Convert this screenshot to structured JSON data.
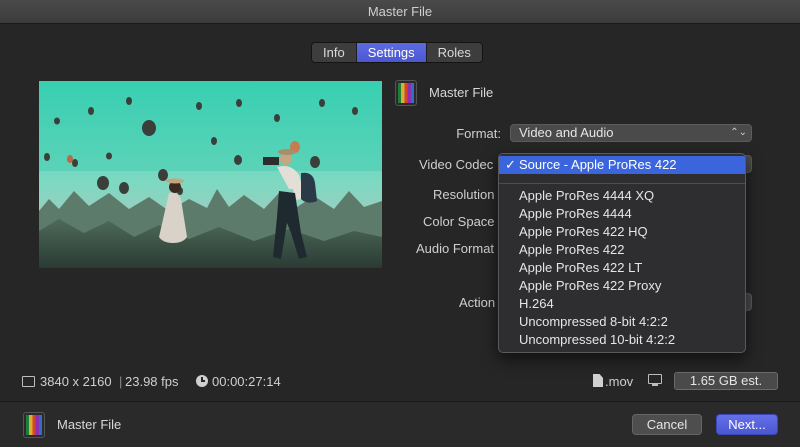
{
  "window": {
    "title": "Master File"
  },
  "tabs": [
    {
      "label": "Info"
    },
    {
      "label": "Settings",
      "active": true
    },
    {
      "label": "Roles"
    }
  ],
  "header": {
    "name": "Master File"
  },
  "fields": {
    "format": {
      "label": "Format:",
      "value": "Video and Audio"
    },
    "video_codec": {
      "label": "Video Codec"
    },
    "resolution": {
      "label": "Resolution"
    },
    "color_space": {
      "label": "Color Space"
    },
    "audio_format": {
      "label": "Audio Format"
    },
    "action": {
      "label": "Action"
    }
  },
  "codec_menu": {
    "selected": "Source - Apple ProRes 422",
    "check": "✓",
    "options": [
      "Apple ProRes 4444 XQ",
      "Apple ProRes 4444",
      "Apple ProRes 422 HQ",
      "Apple ProRes 422",
      "Apple ProRes 422 LT",
      "Apple ProRes 422 Proxy",
      "H.264",
      "Uncompressed 8-bit 4:2:2",
      "Uncompressed 10-bit 4:2:2"
    ]
  },
  "status": {
    "dimensions": "3840 x 2160",
    "fps": "23.98 fps",
    "duration": "00:00:27:14",
    "extension": ".mov",
    "size": "1.65 GB est."
  },
  "footer": {
    "name": "Master File"
  },
  "buttons": {
    "cancel": "Cancel",
    "next": "Next..."
  },
  "colors": {
    "accent": "#4b58cf",
    "menu_highlight": "#3b65dd"
  }
}
